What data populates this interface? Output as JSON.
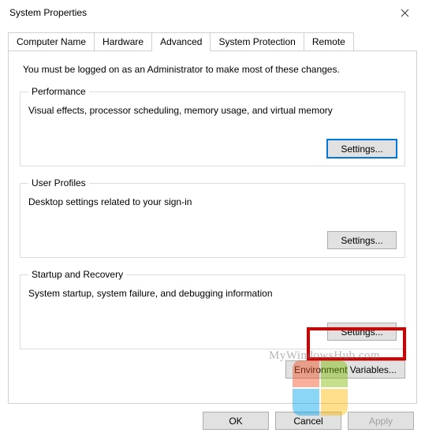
{
  "window": {
    "title": "System Properties"
  },
  "tabs": {
    "t0": "Computer Name",
    "t1": "Hardware",
    "t2": "Advanced",
    "t3": "System Protection",
    "t4": "Remote"
  },
  "intro": "You must be logged on as an Administrator to make most of these changes.",
  "performance": {
    "legend": "Performance",
    "desc": "Visual effects, processor scheduling, memory usage, and virtual memory",
    "button": "Settings..."
  },
  "userprofiles": {
    "legend": "User Profiles",
    "desc": "Desktop settings related to your sign-in",
    "button": "Settings..."
  },
  "startup": {
    "legend": "Startup and Recovery",
    "desc": "System startup, system failure, and debugging information",
    "button": "Settings..."
  },
  "env_button": "Environment Variables...",
  "buttons": {
    "ok": "OK",
    "cancel": "Cancel",
    "apply": "Apply"
  },
  "watermark": "MyWindowsHub.com"
}
